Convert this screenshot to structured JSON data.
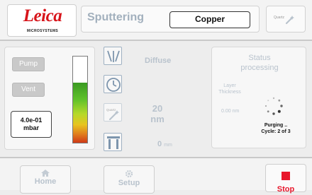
{
  "brand": {
    "logo_text": "Leica",
    "logo_subtext": "MICROSYSTEMS"
  },
  "header": {
    "app_title": "Sputtering",
    "target_button": "Copper",
    "quartz_label": "Quartz"
  },
  "left_panel": {
    "pump_label": "Pump",
    "vent_label": "Vent",
    "pressure_value": "4.0e-01",
    "pressure_unit": "mbar",
    "vacuum_level_fraction": 0.7
  },
  "tools": {
    "mode_label": "Diffuse",
    "quartz_label": "Quartz",
    "thickness_value": "20",
    "thickness_unit": "nm",
    "rate_value": "0",
    "rate_unit": "mm"
  },
  "status": {
    "title_line1": "Status",
    "title_line2": "processing",
    "layer_label_line1": "Layer",
    "layer_label_line2": "Thickness",
    "layer_value": "0.00 nm",
    "purge_line1": "Purging ..",
    "purge_line2": "Cycle: 2 of 3"
  },
  "bottom": {
    "home_label": "Home",
    "setup_label": "Setup",
    "stop_label": "Stop"
  },
  "colors": {
    "accent_red": "#e8162b",
    "logo_red": "#d7141a",
    "disabled_text": "#b9c3cd"
  },
  "icons": [
    "home-icon",
    "gear-icon",
    "stop-icon",
    "diffuse-icon",
    "clock-icon",
    "quartz-icon",
    "tooling-icon",
    "wand-icon",
    "spinner-icon"
  ]
}
